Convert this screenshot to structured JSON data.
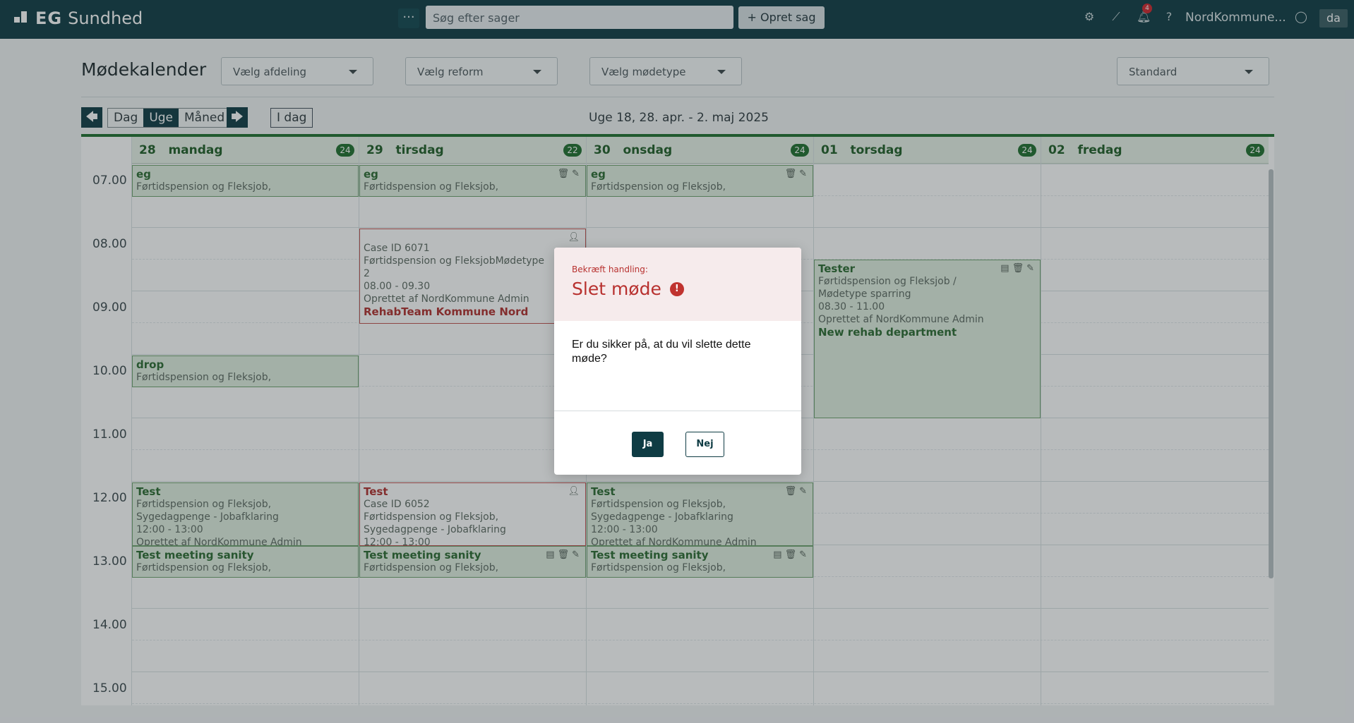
{
  "app": {
    "brand_eg": "EG",
    "brand_name": "Sundhed",
    "user": "NordKommune...",
    "lang": "da",
    "notif_count": "4"
  },
  "search": {
    "placeholder": "Søg efter sager",
    "more": "···"
  },
  "header": {
    "new_case": "Opret sag"
  },
  "icons": {
    "settings": "gear-icon",
    "stats": "trend-icon",
    "bell": "bell-icon",
    "help": "help-icon",
    "profile": "user-icon"
  },
  "page": {
    "title": "Mødekalender"
  },
  "filters": {
    "department": "Vælg afdeling",
    "reform": "Vælg reform",
    "meeting_type": "Vælg mødetype",
    "view": "Standard"
  },
  "toolbar": {
    "day": "Dag",
    "week": "Uge",
    "month": "Måned",
    "today": "I dag",
    "week_label": "Uge 18,   28. apr. - 2. maj 2025"
  },
  "hours": [
    "07.00",
    "08.00",
    "09.00",
    "10.00",
    "11.00",
    "12.00",
    "13.00",
    "14.00",
    "15.00"
  ],
  "days": [
    {
      "num": "28",
      "name": "mandag",
      "count": "24"
    },
    {
      "num": "29",
      "name": "tirsdag",
      "count": "22"
    },
    {
      "num": "30",
      "name": "onsdag",
      "count": "24"
    },
    {
      "num": "01",
      "name": "torsdag",
      "count": "24"
    },
    {
      "num": "02",
      "name": "fredag",
      "count": "24"
    }
  ],
  "events": {
    "mon_eg": {
      "title": "eg",
      "l1": "Førtidspension og Fleksjob,"
    },
    "tue_eg": {
      "title": "eg",
      "l1": "Førtidspension og Fleksjob,"
    },
    "wed_eg": {
      "title": "eg",
      "l1": "Førtidspension og Fleksjob,"
    },
    "tue_case": {
      "l1": "Case ID 6071",
      "l2": "Førtidspension og FleksjobMødetype",
      "l3": "2",
      "l4": "08.00 - 09.30",
      "l5": "Oprettet af NordKommune Admin",
      "team": "RehabTeam Kommune Nord"
    },
    "thu_tester": {
      "title": "Tester",
      "l1": "Førtidspension og Fleksjob /",
      "l2": "Mødetype sparring",
      "l3": "08.30 - 11.00",
      "l4": "Oprettet af NordKommune Admin",
      "team": "New rehab department"
    },
    "mon_drop": {
      "title": "drop",
      "l1": "Førtidspension og Fleksjob,"
    },
    "mon_test": {
      "title": "Test",
      "l1": "Førtidspension og Fleksjob,",
      "l2": "Sygedagpenge - Jobafklaring",
      "l3": "12:00 - 13:00",
      "l4": "Oprettet af NordKommune Admin"
    },
    "tue_test": {
      "title": "Test",
      "l1": "Case ID 6052",
      "l2": "Førtidspension og Fleksjob,",
      "l3": "Sygedagpenge - Jobafklaring",
      "l4": "12:00 - 13:00"
    },
    "wed_test": {
      "title": "Test",
      "l1": "Førtidspension og Fleksjob,",
      "l2": "Sygedagpenge - Jobafklaring",
      "l3": "12:00 - 13:00",
      "l4": "Oprettet af NordKommune Admin"
    },
    "mon_sanity": {
      "title": "Test meeting sanity",
      "l1": "Førtidspension og Fleksjob,"
    },
    "tue_sanity": {
      "title": "Test meeting sanity",
      "l1": "Førtidspension og Fleksjob,"
    },
    "wed_sanity": {
      "title": "Test meeting sanity",
      "l1": "Førtidspension og Fleksjob,"
    }
  },
  "modal": {
    "subtitle": "Bekræft handling:",
    "title": "Slet møde",
    "message": "Er du sikker på, at du vil slette dette møde?",
    "yes": "Ja",
    "no": "Nej"
  }
}
